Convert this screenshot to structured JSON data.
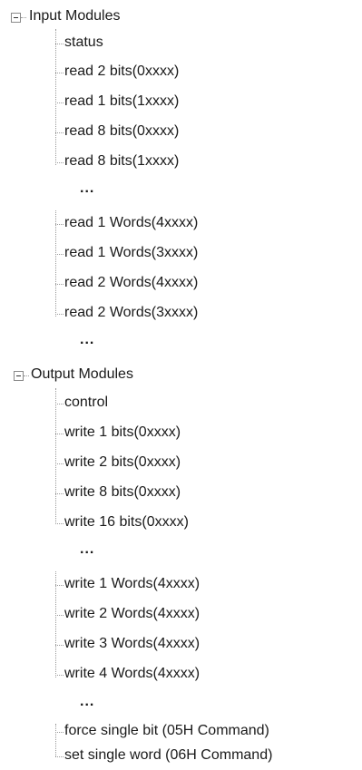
{
  "tree": {
    "input_modules": {
      "label": "Input Modules",
      "items_a": [
        "status",
        "read 2 bits(0xxxx)",
        "read 1 bits(1xxxx)",
        "read 8 bits(0xxxx)",
        "read 8 bits(1xxxx)"
      ],
      "items_b": [
        "read 1 Words(4xxxx)",
        "read 1 Words(3xxxx)",
        "read 2 Words(4xxxx)",
        "read 2 Words(3xxxx)"
      ]
    },
    "output_modules": {
      "label": "Output Modules",
      "items_a": [
        "control",
        "write 1 bits(0xxxx)",
        "write 2 bits(0xxxx)",
        "write 8 bits(0xxxx)",
        "write 16 bits(0xxxx)"
      ],
      "items_b": [
        "write 1 Words(4xxxx)",
        "write 2 Words(4xxxx)",
        "write 3 Words(4xxxx)",
        "write 4 Words(4xxxx)"
      ],
      "items_c": [
        "force single bit (05H Command)",
        "set single word (06H Command)"
      ]
    },
    "ellipsis": "..."
  },
  "icons": {
    "collapse": "minus-box-icon"
  }
}
